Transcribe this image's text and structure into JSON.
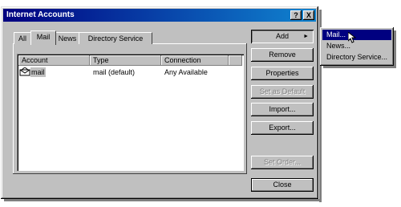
{
  "window": {
    "title": "Internet Accounts",
    "help_glyph": "?",
    "close_glyph": "X"
  },
  "tabs": [
    {
      "label": "All"
    },
    {
      "label": "Mail"
    },
    {
      "label": "News"
    },
    {
      "label": "Directory Service"
    }
  ],
  "columns": [
    "Account",
    "Type",
    "Connection"
  ],
  "accounts": [
    {
      "account": "mail",
      "type": "mail (default)",
      "connection": "Any Available"
    }
  ],
  "buttons": {
    "add": "Add",
    "add_arrow": "►",
    "remove": "Remove",
    "properties": "Properties",
    "set_default": "Set as Default",
    "import": "Import...",
    "export": "Export...",
    "set_order": "Set Order...",
    "close": "Close"
  },
  "add_menu": [
    {
      "label": "Mail...",
      "selected": true
    },
    {
      "label": "News...",
      "selected": false
    },
    {
      "label": "Directory Service...",
      "selected": false
    }
  ],
  "icons": {
    "account": "mail-account-icon",
    "cursor": "mouse-pointer-icon"
  }
}
